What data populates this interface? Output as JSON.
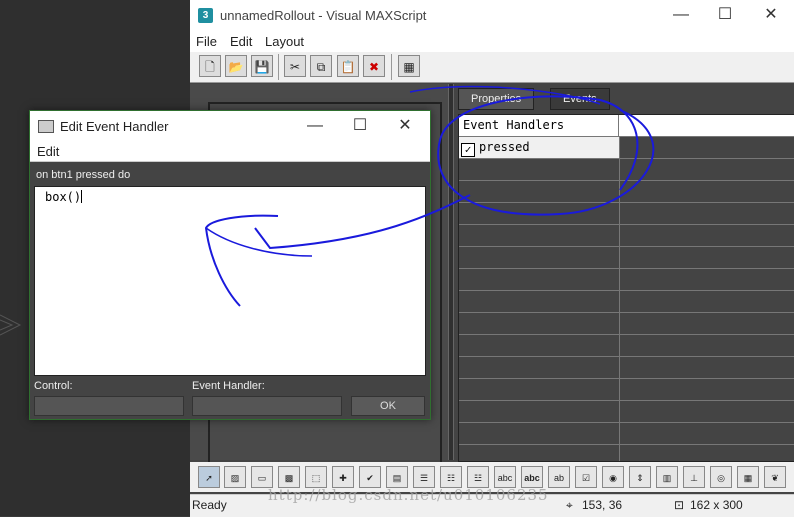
{
  "main": {
    "title": "unnamedRollout - Visual MAXScript",
    "app_icon": "3",
    "menu": [
      "File",
      "Edit",
      "Layout"
    ],
    "toolbar_icons": [
      "new-icon",
      "open-icon",
      "save-icon",
      "cut-icon",
      "copy-icon",
      "paste-icon",
      "delete-icon",
      "grid-icon"
    ],
    "tabs": [
      "Properties",
      "Events"
    ],
    "grid_header": "Event Handlers",
    "grid_item": "pressed",
    "grid_item_checked": true,
    "status": {
      "ready": "Ready",
      "coords": "153, 36",
      "size": "162 x 300"
    }
  },
  "dialog": {
    "title": "Edit Event Handler",
    "menu": "Edit",
    "header": "on btn1 pressed  do",
    "code": "box()",
    "control_label": "Control:",
    "handler_label": "Event Handler:",
    "ok_label": "OK"
  },
  "watermark": "http://blog.csdn.net/u010106235",
  "colors": {
    "annotation": "#1a1adc",
    "dialog_border": "#2f6f2f"
  }
}
